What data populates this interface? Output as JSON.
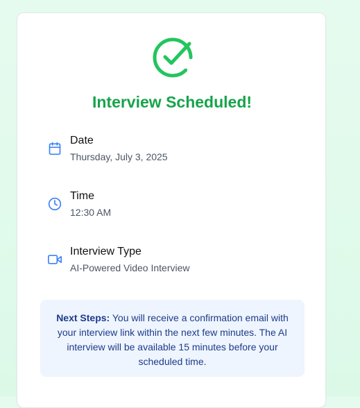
{
  "confirmation": {
    "title": "Interview Scheduled!",
    "success_icon": "check-circle-icon",
    "accent_color": "#16a34a"
  },
  "details": [
    {
      "icon": "calendar-icon",
      "label": "Date",
      "value": "Thursday, July 3, 2025"
    },
    {
      "icon": "clock-icon",
      "label": "Time",
      "value": "12:30 AM"
    },
    {
      "icon": "video-camera-icon",
      "label": "Interview Type",
      "value": "AI-Powered Video Interview"
    }
  ],
  "next_steps": {
    "heading": "Next Steps:",
    "text": "You will receive a confirmation email with your interview link within the next few minutes. The AI interview will be available 15 minutes before your scheduled time."
  },
  "colors": {
    "icon_blue": "#3b82f6",
    "note_background": "#eef5fe",
    "note_text": "#1e3a8a"
  }
}
